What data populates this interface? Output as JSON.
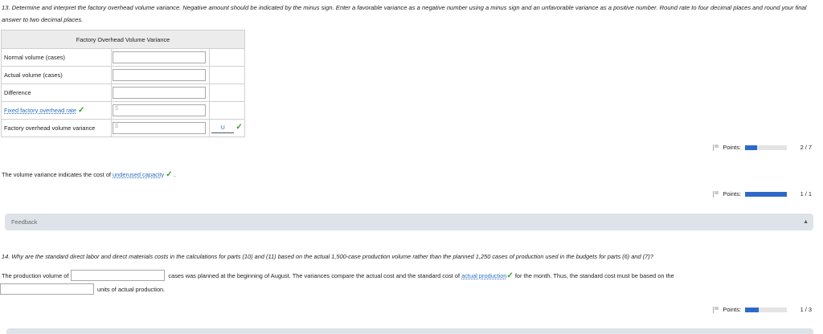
{
  "q13": {
    "instructions": "13. Determine and interpret the factory overhead volume variance. Negative amount should be indicated by the minus sign. Enter a favorable variance as a negative number using a minus sign and an unfavorable variance as a positive number. Round rate to four decimal places and round your final answer to two decimal places.",
    "table_title": "Factory Overhead Volume Variance",
    "rows": [
      {
        "label": "Normal volume (cases)",
        "value": ""
      },
      {
        "label": "Actual volume (cases)",
        "value": ""
      },
      {
        "label": "Difference",
        "value": ""
      },
      {
        "label": "Fixed factory overhead rate",
        "value": "",
        "prefix": "$"
      },
      {
        "label": "Factory overhead volume variance",
        "value": "",
        "prefix": "$",
        "status": "U"
      }
    ],
    "points": {
      "label": "Points:",
      "score": "2 / 7",
      "fraction": 0.2857
    },
    "volume_sentence_prefix": "The volume variance indicates the cost of",
    "volume_answer": "underused capacity",
    "volume_sentence_suffix": ".",
    "points2": {
      "label": "Points:",
      "score": "1 / 1",
      "fraction": 1.0
    }
  },
  "feedback": {
    "label": "Feedback"
  },
  "q14": {
    "question": "14. Why are the standard direct labor and direct materials costs in the calculations for parts (10) and (11) based on the actual 1,500-case production volume rather than the planned 1,250 cases of production used in the budgets for parts (6) and (7)?",
    "text1": "The production volume of",
    "text2": "cases was planned at the beginning of August. The variances compare the actual cost and the standard cost of",
    "answer": "actual production",
    "text3": "for the month. Thus, the standard cost must be based on the",
    "text4": "units of actual production.",
    "points": {
      "label": "Points:",
      "score": "1 / 3",
      "fraction": 0.3333
    }
  },
  "colors": {
    "accent": "#2e69c9",
    "check": "#3a9a2a",
    "link": "#2a6ebd"
  }
}
